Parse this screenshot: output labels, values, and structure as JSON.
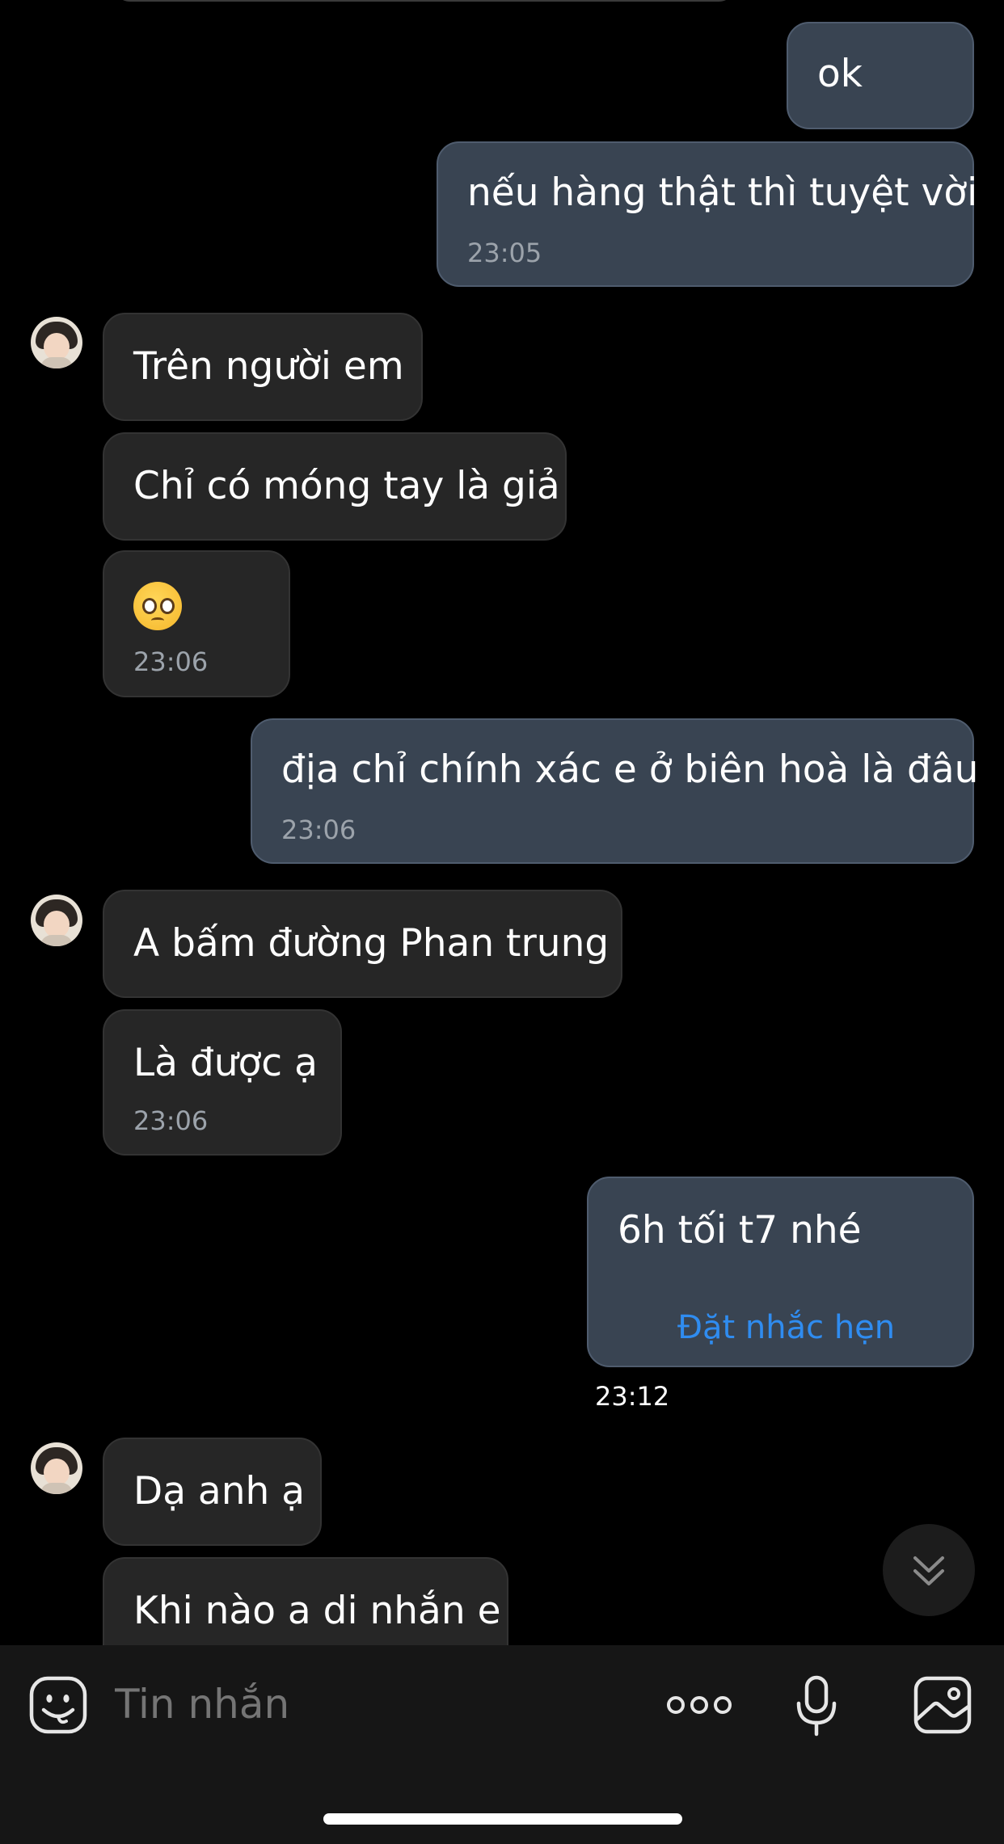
{
  "messages": [
    {
      "id": "m1",
      "direction": "outgoing",
      "text": "ok",
      "time": ""
    },
    {
      "id": "m2",
      "direction": "outgoing",
      "text": "nếu hàng thật thì tuyệt vời",
      "time": "23:05"
    },
    {
      "id": "m3",
      "direction": "incoming",
      "text": "Trên người em",
      "time": ""
    },
    {
      "id": "m4",
      "direction": "incoming",
      "text": "Chỉ có móng tay là giả",
      "time": ""
    },
    {
      "id": "m5",
      "direction": "incoming",
      "emoji": "pleading-face",
      "time": "23:06"
    },
    {
      "id": "m6",
      "direction": "outgoing",
      "text": "địa chỉ chính xác e ở biên hoà là đâu",
      "time": "23:06"
    },
    {
      "id": "m7",
      "direction": "incoming",
      "text": "A bấm đường Phan trung",
      "time": ""
    },
    {
      "id": "m8",
      "direction": "incoming",
      "text": "Là được ạ",
      "time": "23:06"
    },
    {
      "id": "m9",
      "direction": "outgoing",
      "text": "6h tối t7 nhé",
      "action": "Đặt nhắc hẹn",
      "time": "23:12"
    },
    {
      "id": "m10",
      "direction": "incoming",
      "text": "Dạ anh ạ",
      "time": ""
    },
    {
      "id": "m11",
      "direction": "incoming",
      "text": "Khi nào a di nhắn e",
      "time": ""
    }
  ],
  "composer": {
    "placeholder": "Tin nhắn",
    "icons": [
      "sticker-icon",
      "more-icon",
      "microphone-icon",
      "image-icon"
    ]
  },
  "scroll_button": {
    "icon": "double-chevron-down-icon"
  },
  "colors": {
    "background": "#000000",
    "outgoing_bubble": "#394452",
    "incoming_bubble": "#262626",
    "link": "#2f8cf0",
    "timestamp": "#9ca3ab"
  }
}
